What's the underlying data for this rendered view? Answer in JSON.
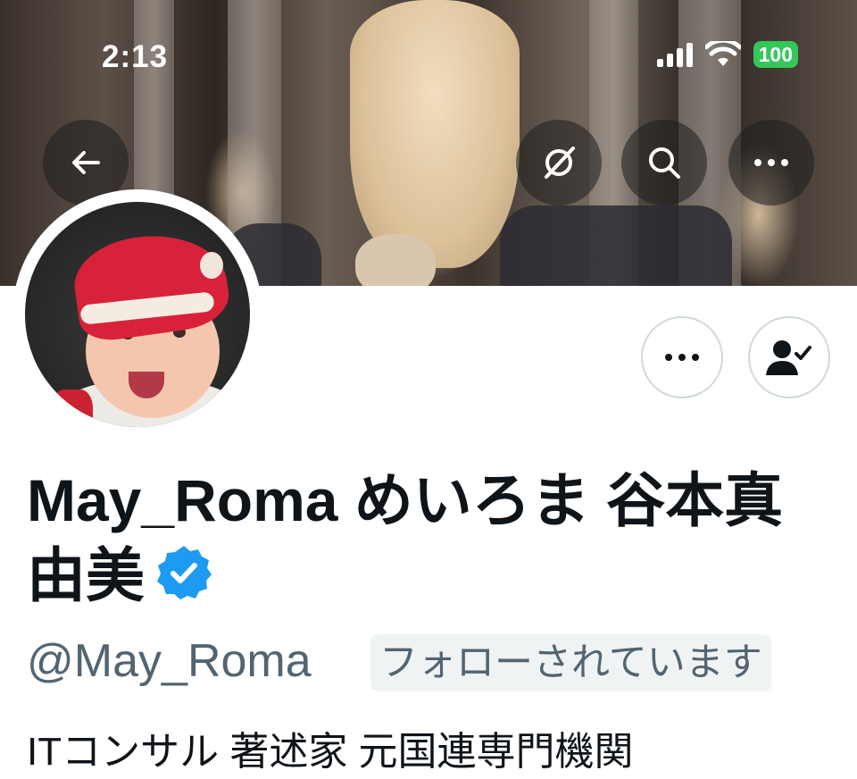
{
  "status_bar": {
    "time": "2:13",
    "battery": "100",
    "icons": [
      "cellular-signal-icon",
      "wifi-icon",
      "battery-icon"
    ]
  },
  "top_nav": {
    "buttons": [
      "back-arrow-icon",
      "grok-icon",
      "search-icon",
      "more-icon"
    ]
  },
  "profile": {
    "display_name": "May_Roma めいろま 谷本真由美",
    "verified": true,
    "handle": "@May_Roma",
    "follows_you": "フォローされています",
    "bio": "ITコンサル 著述家 元国連専門機関"
  },
  "actions": [
    "more-options-icon",
    "following-user-icon"
  ],
  "colors": {
    "text_primary": "#0f1419",
    "text_secondary": "#536471",
    "verified_blue": "#1d9bf0",
    "battery_green": "#34c759",
    "button_border": "#cfd9de",
    "badge_bg": "#eff3f4"
  }
}
